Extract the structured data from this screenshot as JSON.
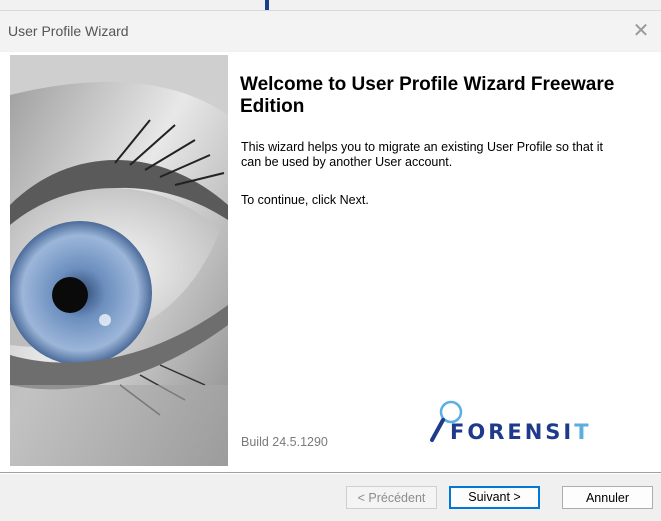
{
  "window": {
    "title": "User Profile Wizard",
    "close_glyph": "✕"
  },
  "main": {
    "heading": "Welcome to User Profile Wizard Freeware Edition",
    "description": "This wizard helps you to migrate an existing User Profile so that it can be used by another User account.",
    "instruction": "To continue, click Next.",
    "build": "Build 24.5.1290",
    "side_image": "eye-photo",
    "logo": {
      "text_main": "FORENSI",
      "text_last": "T",
      "icon": "magnifier-icon"
    }
  },
  "footer": {
    "back_label": "< Précédent",
    "next_label": "Suivant >",
    "cancel_label": "Annuler"
  },
  "colors": {
    "logo_primary": "#1f3a8a",
    "logo_accent": "#5aaee0",
    "focus_border": "#0078d7"
  }
}
